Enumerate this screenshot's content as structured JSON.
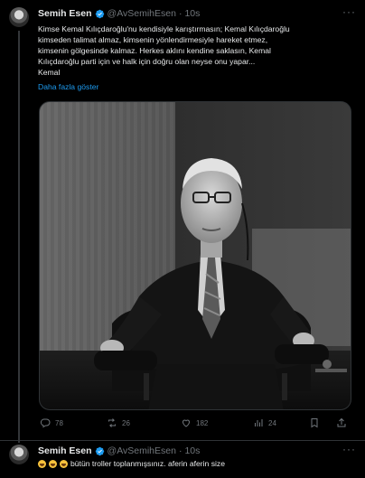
{
  "main_tweet": {
    "author_name": "Semih Esen",
    "author_handle": "@AvSemihEsen",
    "separator": "·",
    "time": "10s",
    "text_lines": [
      "Kimse Kemal Kılıçdaroğlu'nu kendisiyle karıştırmasın; Kemal Kılıçdaroğlu",
      "kimseden talimat almaz, kimsenin yönlendirmesiyle hareket etmez,",
      "kimsenin gölgesinde kalmaz. Herkes aklını kendine saklasın, Kemal",
      "Kılıçdaroğlu parti için ve halk için doğru olan neyse onu yapar...",
      "Kemal"
    ],
    "show_more": "Daha fazla göster",
    "actions": {
      "replies": "78",
      "reposts": "26",
      "likes": "182",
      "views": "24"
    }
  },
  "reply_tweet": {
    "author_name": "Semih Esen",
    "author_handle": "@AvSemihEsen",
    "separator": "·",
    "time": "10s",
    "text": "bütün troller toplanmışsınız. aferin aferin size"
  },
  "icons": {
    "verified": "verified-badge-icon",
    "more": "more-icon",
    "reply": "reply-icon",
    "repost": "repost-icon",
    "like": "heart-icon",
    "views": "views-icon",
    "bookmark": "bookmark-icon",
    "share": "share-icon"
  },
  "colors": {
    "background": "#000000",
    "text": "#e7e9ea",
    "secondary": "#71767b",
    "link": "#1d9bf0",
    "divider": "#2f3336"
  }
}
